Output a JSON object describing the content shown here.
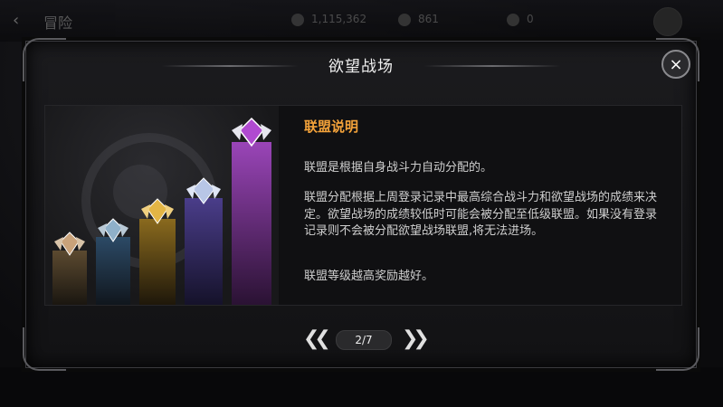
{
  "topbar": {
    "back_icon": "back-arrow-icon",
    "title": "冒险",
    "resources": [
      {
        "icon": "coin-icon",
        "value": "1,115,362"
      },
      {
        "icon": "gem-icon",
        "value": "861"
      },
      {
        "icon": "stamina-icon",
        "value": "0"
      }
    ]
  },
  "modal": {
    "title": "欲望战场",
    "close_label": "×",
    "heading": "联盟说明",
    "paragraphs": [
      "联盟是根据自身战斗力自动分配的。",
      "联盟分配根据上周登录记录中最高综合战斗力和欲望战场的成绩来决定。欲望战场的成绩较低时可能会被分配至低级联盟。如果没有登录记录则不会被分配欲望战场联盟,将无法进场。",
      "联盟等级越高奖励越好。"
    ],
    "tiers": [
      {
        "level": 1,
        "color": "#6b5a3a"
      },
      {
        "level": 2,
        "color": "#2e4a63"
      },
      {
        "level": 3,
        "color": "#8a6a1e"
      },
      {
        "level": 4,
        "color": "#4a3d8a"
      },
      {
        "level": 5,
        "color": "#8a3aa8"
      }
    ],
    "pager": {
      "current": "2/7",
      "prev_icon": "double-chevron-left-icon",
      "next_icon": "double-chevron-right-icon"
    }
  }
}
